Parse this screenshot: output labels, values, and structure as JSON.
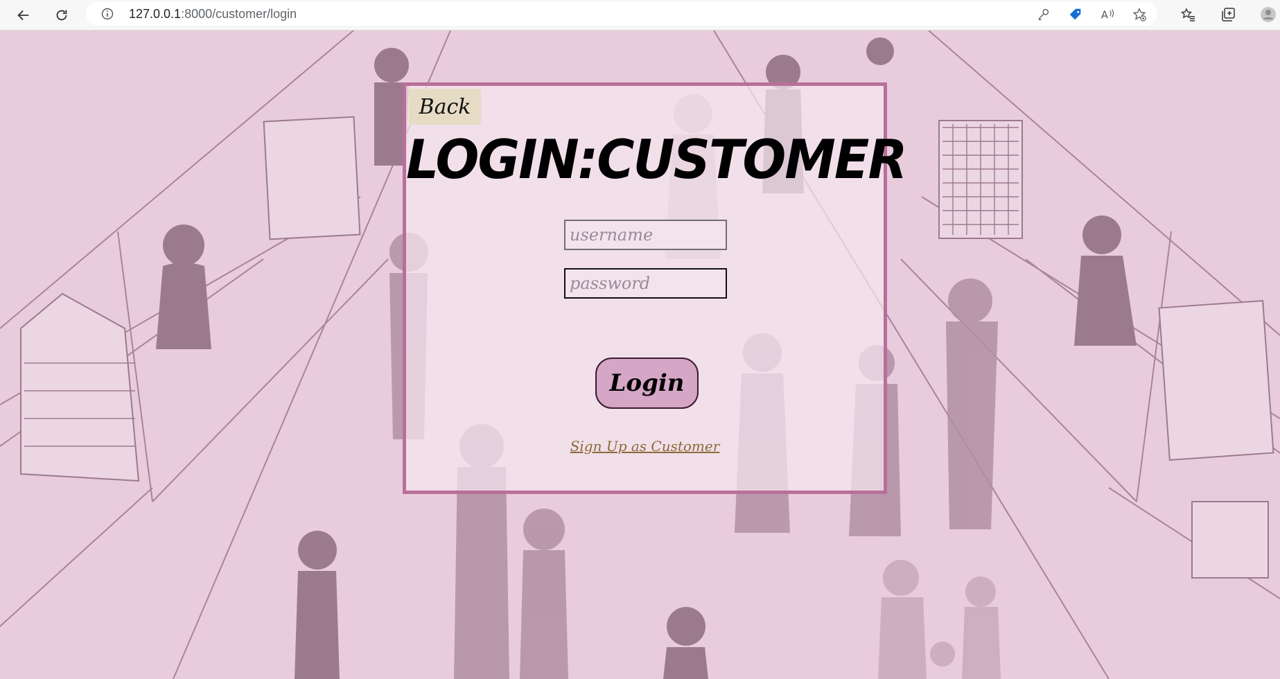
{
  "browser": {
    "url_host": "127.0.0.1",
    "url_rest": ":8000/customer/login",
    "icons": [
      "back-arrow-icon",
      "reload-icon",
      "site-info-icon",
      "key-icon",
      "price-tag-icon",
      "read-aloud-icon",
      "add-favorite-icon",
      "favorites-icon",
      "collections-icon",
      "profile-avatar-icon"
    ]
  },
  "page": {
    "back_label": "Back",
    "title": "LOGIN:CUSTOMER",
    "username_placeholder": "username",
    "password_placeholder": "password",
    "login_label": "Login",
    "signup_label": "Sign Up as Customer"
  },
  "colors": {
    "background": "#e8ccdb",
    "card_border": "#b96f9b",
    "back_button": "#e6dcc6",
    "login_button": "#d5a6c5",
    "link": "#8a6a3a"
  }
}
